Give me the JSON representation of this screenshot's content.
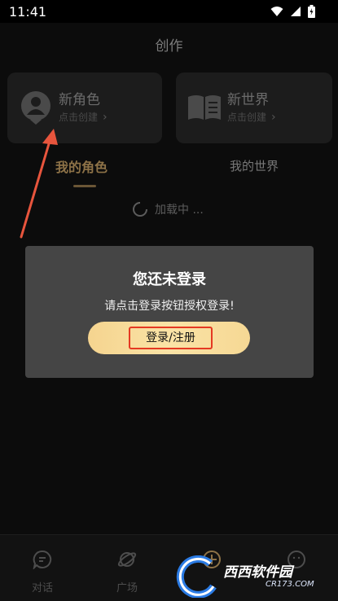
{
  "status_bar": {
    "time": "11:41",
    "icons": [
      "wifi-icon",
      "signal-icon",
      "battery-icon"
    ]
  },
  "header": {
    "title": "创作"
  },
  "cards": {
    "role": {
      "title": "新角色",
      "subtitle": "点击创建",
      "icon": "user-avatar-icon"
    },
    "world": {
      "title": "新世界",
      "subtitle": "点击创建",
      "icon": "book-icon"
    }
  },
  "tabs": [
    {
      "label": "我的角色",
      "active": true
    },
    {
      "label": "我的世界",
      "active": false
    }
  ],
  "loading": {
    "text": "加载中 ..."
  },
  "dialog": {
    "title": "您还未登录",
    "message": "请点击登录按钮授权登录!",
    "button_label": "登录/注册"
  },
  "bottom_nav": [
    {
      "label": "对话",
      "icon": "chat-icon"
    },
    {
      "label": "广场",
      "icon": "planet-icon"
    },
    {
      "label": "",
      "icon": "add-icon"
    },
    {
      "label": "",
      "icon": "smile-icon"
    }
  ],
  "watermark": {
    "text": "西西软件园",
    "sub": "CR173.COM"
  },
  "colors": {
    "accent_gold": "#8d7247",
    "button_gold": "#f7dc9c",
    "highlight_red": "#e53922",
    "dialog_bg": "#454545"
  }
}
